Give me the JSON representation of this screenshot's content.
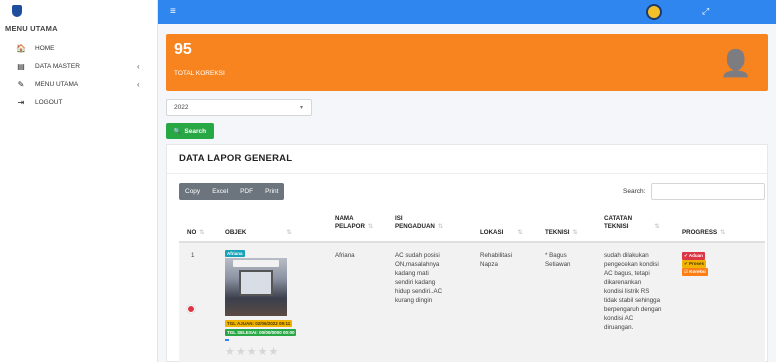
{
  "sidebar": {
    "menu_header": "MENU UTAMA",
    "items": [
      {
        "label": "HOME",
        "icon": "home-icon",
        "glyph": "🏠"
      },
      {
        "label": "DATA MASTER",
        "icon": "database-icon",
        "glyph": "▤",
        "chevron": "‹"
      },
      {
        "label": "MENU UTAMA",
        "icon": "edit-icon",
        "glyph": "✎",
        "chevron": "‹"
      },
      {
        "label": "LOGOUT",
        "icon": "logout-icon",
        "glyph": "⇥"
      }
    ]
  },
  "topbar": {
    "menu_glyph": "≡",
    "expand_glyph": "⤢"
  },
  "stat": {
    "number": "95",
    "label": "TOTAL KOREKSI",
    "icon": "user-plus-icon",
    "glyph": "👤"
  },
  "filter": {
    "year": "2022",
    "caret": "▾"
  },
  "search_button": {
    "label": "Search",
    "glyph": "🔍"
  },
  "card": {
    "title": "DATA LAPOR GENERAL"
  },
  "table_tools": {
    "buttons": [
      "Copy",
      "Excel",
      "PDF",
      "Print"
    ],
    "search_label": "Search:",
    "search_value": ""
  },
  "table": {
    "sort_glyph": "⇅",
    "columns": {
      "no": "NO",
      "objek": "OBJEK",
      "nama_pelapor": [
        "NAMA",
        "PELAPOR"
      ],
      "isi_pengaduan": [
        "ISI",
        "PENGADUAN"
      ],
      "lokasi": "LOKASI",
      "teknisi": "TEKNISI",
      "catatan_teknisi": [
        "CATATAN",
        "TEKNISI"
      ],
      "progress": "PROGRESS"
    },
    "rows": [
      {
        "no": "1",
        "objek_badge": "Afriana",
        "tgl_ajuan": "TGL AJUAN: 02/06/2022 09:11",
        "tgl_selesai": "TGL SELESAI: 00/00/0000 00:00",
        "stars": "★★★★★",
        "nama_pelapor": "Afriana",
        "isi_pengaduan": [
          "AC sudah posisi",
          "ON,masalahnya",
          "kadang mati",
          "sendiri kadang",
          "hidup sendiri..AC",
          "kurang dingin"
        ],
        "lokasi": [
          "Rehabilitasi",
          "Napza"
        ],
        "teknisi": [
          "* Bagus",
          "Setiawan"
        ],
        "catatan_teknisi": [
          "sudah dilakukan",
          "pengecekan kondisi",
          "AC bagus, tetapi",
          "dikarenankan",
          "kondisi listrik RS",
          "tidak stabil sehingga",
          "berpengaruh dengan",
          "kondisi AC",
          "diruangan."
        ],
        "progress": [
          "✔ Aduan",
          "✔ Proses",
          "☑ Koreksi"
        ]
      }
    ]
  },
  "colors": {
    "topbar": "#2e86ee",
    "stat_box": "#f7841f",
    "search_button": "#28a745",
    "table_tools": "#6c757d",
    "row_toggle": "#dc3545"
  }
}
